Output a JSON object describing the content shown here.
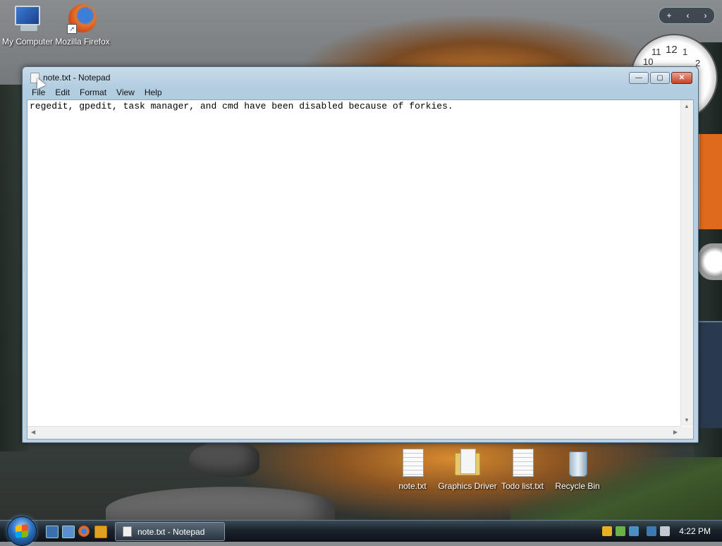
{
  "desktop": {
    "icons_top": [
      {
        "label": "My Computer"
      },
      {
        "label": "Mozilla Firefox"
      }
    ],
    "icons_bottom": [
      {
        "label": "note.txt"
      },
      {
        "label": "Graphics Driver"
      },
      {
        "label": "Todo list.txt"
      },
      {
        "label": "Recycle Bin"
      }
    ]
  },
  "gadgets": {
    "add_label": "+",
    "prev_label": "‹",
    "next_label": "›",
    "clock_numbers": [
      "12",
      "10",
      "11",
      "1",
      "2"
    ]
  },
  "window": {
    "title": "note.txt - Notepad",
    "minimize_label": "—",
    "maximize_label": "▢",
    "close_label": "✕",
    "menu": [
      "File",
      "Edit",
      "Format",
      "View",
      "Help"
    ],
    "content": "regedit, gpedit, task manager, and cmd have been disabled because of forkies."
  },
  "taskbar": {
    "active_task": "note.txt - Notepad",
    "clock": "4:22 PM"
  },
  "colors": {
    "taskbar": "#0d1318",
    "window_frame": "#b2cde0",
    "close_button": "#c4412c"
  }
}
